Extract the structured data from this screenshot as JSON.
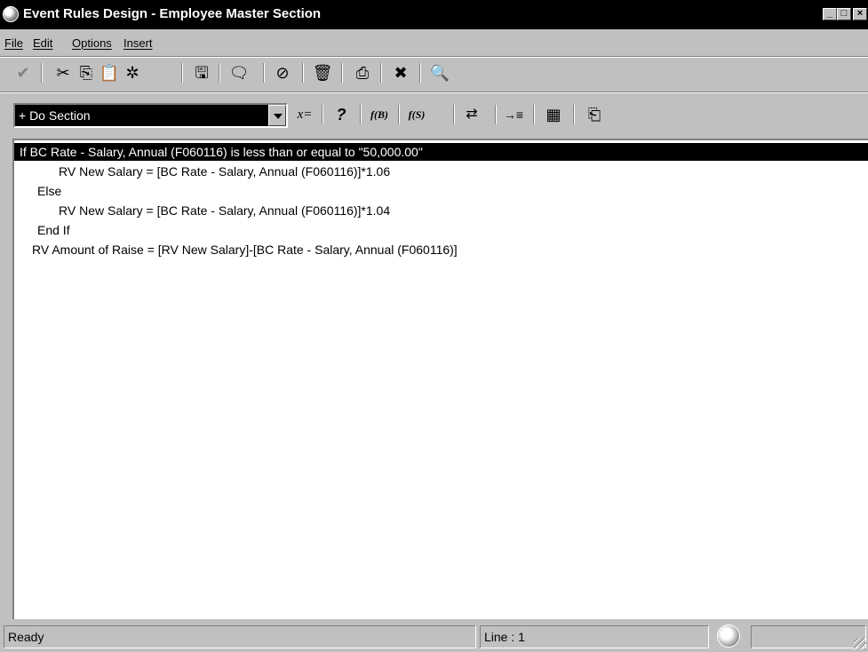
{
  "window": {
    "title": "Event Rules Design - Employee Master Section",
    "controls": {
      "minimize": "_",
      "maximize": "□",
      "close": "×"
    }
  },
  "menu": [
    {
      "label": "File"
    },
    {
      "label": "Edit"
    },
    {
      "label": "Options"
    },
    {
      "label": "Insert"
    }
  ],
  "toolbar": {
    "buttons": [
      {
        "icon": "checkmark-icon",
        "glyph": "✔"
      },
      {
        "icon": "cut-icon",
        "glyph": "✂"
      },
      {
        "icon": "copy-icon",
        "glyph": "⎘"
      },
      {
        "icon": "paste-icon",
        "glyph": "📋"
      },
      {
        "icon": "paste-special-icon",
        "glyph": "✲"
      },
      {
        "icon": "save-icon",
        "glyph": "🖫"
      },
      {
        "icon": "comment-icon",
        "glyph": "🗨"
      },
      {
        "icon": "disable-icon",
        "glyph": "⊘"
      },
      {
        "icon": "delete-icon",
        "glyph": "🗑"
      },
      {
        "icon": "print-icon",
        "glyph": "⎙"
      },
      {
        "icon": "cancel-icon",
        "glyph": "✖"
      },
      {
        "icon": "search-icon",
        "glyph": "🔍"
      }
    ],
    "section_select": {
      "value": "+ Do Section"
    },
    "second_row": [
      {
        "icon": "assignment-icon",
        "glyph": "x="
      },
      {
        "icon": "if-condition-icon",
        "glyph": "?"
      },
      {
        "icon": "business-function-icon",
        "glyph": "f(B)"
      },
      {
        "icon": "system-function-icon",
        "glyph": "f(S)"
      },
      {
        "icon": "variables-icon",
        "glyph": "⇄"
      },
      {
        "icon": "indent-icon",
        "glyph": "→≡"
      },
      {
        "icon": "table-io-icon",
        "glyph": "▦"
      },
      {
        "icon": "form-interconnect-icon",
        "glyph": "⎗"
      }
    ]
  },
  "code": [
    "If BC Rate - Salary, Annual (F060116) is less than or equal to \"50,000.00\"",
    "RV New Salary = [BC Rate - Salary, Annual (F060116)]*1.06",
    "Else",
    "RV New Salary = [BC Rate - Salary, Annual (F060116)]*1.04",
    "End If",
    "RV Amount of Raise = [RV New Salary]-[BC Rate - Salary, Annual (F060116)]"
  ],
  "status": {
    "message": "Ready",
    "line": "Line : 1"
  }
}
